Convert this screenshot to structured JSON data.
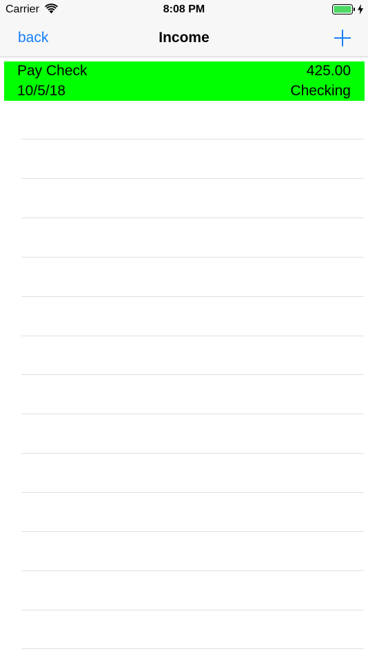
{
  "status_bar": {
    "carrier": "Carrier",
    "time": "8:08 PM",
    "icons": [
      "wifi-icon",
      "battery-icon",
      "charging-icon"
    ],
    "battery_color": "#4cd964"
  },
  "nav": {
    "back_label": "back",
    "title": "Income",
    "add_icon": "plus-icon",
    "tint_color": "#147efb"
  },
  "income": {
    "highlight_color": "#00ff00",
    "rows": [
      {
        "title": "Pay Check",
        "amount": "425.00",
        "date": "10/5/18",
        "account": "Checking"
      }
    ]
  }
}
